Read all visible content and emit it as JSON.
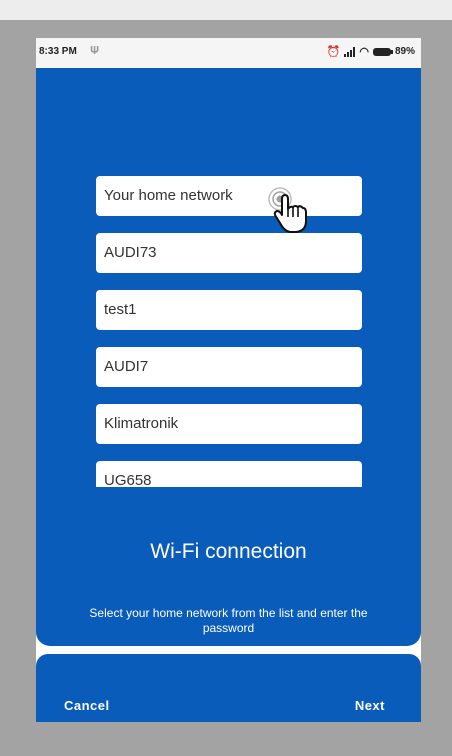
{
  "status_bar": {
    "time": "8:33 PM",
    "battery": "89%",
    "icons": [
      "wifi-icon",
      "alarm-icon",
      "signal-icon",
      "battery-icon"
    ]
  },
  "network_list": {
    "items": [
      {
        "label": "Your home network"
      },
      {
        "label": "AUDI73"
      },
      {
        "label": "test1"
      },
      {
        "label": "AUDI7"
      },
      {
        "label": "Klimatronik"
      },
      {
        "label": "UG658"
      }
    ]
  },
  "main": {
    "title": "Wi-Fi connection",
    "instruction": "Select your home network from the list and enter the password"
  },
  "footer": {
    "cancel_label": "Cancel",
    "next_label": "Next"
  },
  "colors": {
    "primary": "#0a5cba",
    "background": "#a3a3a3"
  }
}
